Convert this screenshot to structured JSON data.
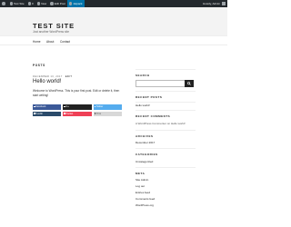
{
  "admin_bar": {
    "items": [
      {
        "label": "WP",
        "icon": "wordpress-icon"
      },
      {
        "label": "Test Site",
        "icon": "home-icon"
      },
      {
        "label": "0",
        "icon": "comments-icon"
      },
      {
        "label": "New",
        "icon": "plus-icon"
      },
      {
        "label": "Edit Post",
        "icon": "pencil-icon"
      },
      {
        "label": "Jetpack",
        "icon": "jetpack-icon"
      }
    ],
    "greeting": "Howdy, Admin"
  },
  "site": {
    "title": "TEST SITE",
    "description": "Just another WordPress site"
  },
  "nav": {
    "items": [
      "Home",
      "About",
      "Contact"
    ]
  },
  "posts_heading": "POSTS",
  "post": {
    "date": "DECEMBER 13, 2017",
    "edit_label": "EDIT",
    "title": "Hello world!",
    "body": "Welcome to WordPress. This is your first post. Edit or delete it, then start writing!"
  },
  "share": {
    "buttons": [
      {
        "label": "Facebook",
        "color": "#3b5998"
      },
      {
        "label": "G+",
        "color": "#222222"
      },
      {
        "label": "Twitter",
        "color": "#55acee"
      },
      {
        "label": "Tumblr",
        "color": "#2b4b6a"
      },
      {
        "label": "Pocket",
        "color": "#ef4056"
      },
      {
        "label": "Print",
        "color": "#d8d8d8"
      }
    ]
  },
  "sidebar": {
    "search_title": "SEARCH",
    "search_placeholder": "",
    "recent_posts_title": "RECENT POSTS",
    "recent_posts": [
      "Hello world!"
    ],
    "recent_comments_title": "RECENT COMMENTS",
    "recent_comments": [
      "A WordPress Commenter on Hello world!"
    ],
    "archives_title": "ARCHIVES",
    "archives": [
      "December 2017"
    ],
    "categories_title": "CATEGORIES",
    "categories": [
      "Uncategorized"
    ],
    "meta_title": "META",
    "meta": [
      "Site Admin",
      "Log out",
      "Entries feed",
      "Comments feed",
      "WordPress.org"
    ]
  },
  "colors": {
    "admin_bar": "#23282d",
    "accent": "#0073aa",
    "header_bg": "#f3f3f3"
  }
}
